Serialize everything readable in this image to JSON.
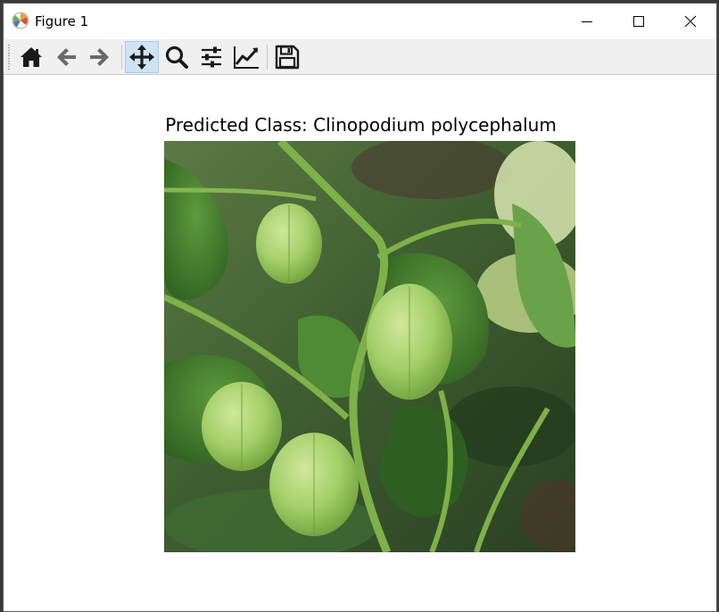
{
  "window": {
    "title": "Figure 1",
    "buttons": [
      "minimize-icon",
      "maximize-icon",
      "close-icon"
    ]
  },
  "toolbar": {
    "buttons": [
      {
        "name": "home",
        "icon": "home-icon"
      },
      {
        "name": "back",
        "icon": "arrow-left-icon"
      },
      {
        "name": "forward",
        "icon": "arrow-right-icon"
      },
      {
        "name": "pan",
        "icon": "move-icon",
        "active": true
      },
      {
        "name": "zoom",
        "icon": "magnifier-icon"
      },
      {
        "name": "configure-subplots",
        "icon": "sliders-icon"
      },
      {
        "name": "edit-axes",
        "icon": "line-chart-icon"
      },
      {
        "name": "save",
        "icon": "floppy-disk-icon"
      }
    ]
  },
  "figure": {
    "title": "Predicted Class: Clinopodium polycephalum",
    "image_subject": "green husk-covered fruits hanging from a leafy plant"
  },
  "colors": {
    "active_tool_bg": "#cfe3f5",
    "toolbar_bg": "#f0f0f0",
    "icon": "#1a1a1a"
  }
}
